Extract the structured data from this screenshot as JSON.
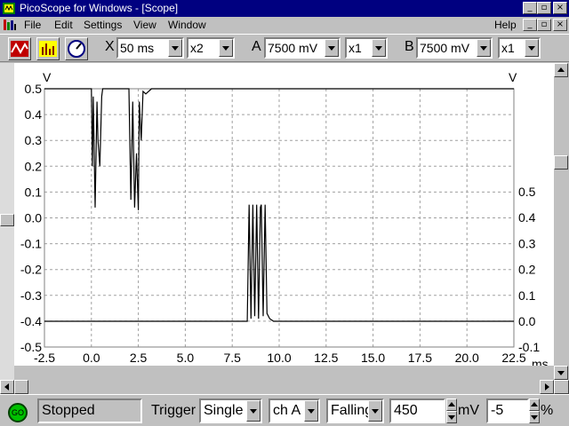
{
  "window": {
    "title": "PicoScope for Windows - [Scope]"
  },
  "menu": {
    "file": "File",
    "edit": "Edit",
    "settings": "Settings",
    "view": "View",
    "window": "Window",
    "help": "Help"
  },
  "toolbar": {
    "x_label": "X",
    "timebase": "50 ms",
    "x_mult": "x2",
    "a_label": "A",
    "a_range": "7500 mV",
    "a_mult": "x1",
    "b_label": "B",
    "b_range": "7500 mV",
    "b_mult": "x1"
  },
  "status": {
    "go": "GO",
    "state": "Stopped",
    "trigger_label": "Trigger",
    "mode": "Single",
    "channel": "ch A",
    "edge": "Falling",
    "level": "450",
    "level_unit": "mV",
    "delay": "-5",
    "delay_unit": "%"
  },
  "chart_data": {
    "type": "line",
    "xlabel": "ms",
    "left_ylabel": "V",
    "right_ylabel": "V",
    "x_ticks": [
      "-2.5",
      "0.0",
      "2.5",
      "5.0",
      "7.5",
      "10.0",
      "12.5",
      "15.0",
      "17.5",
      "20.0",
      "22.5"
    ],
    "left_ticks": [
      "0.5",
      "0.4",
      "0.3",
      "0.2",
      "0.1",
      "0.0",
      "-0.1",
      "-0.2",
      "-0.3",
      "-0.4",
      "-0.5"
    ],
    "right_ticks": [
      "0.5",
      "0.4",
      "0.3",
      "0.2",
      "0.1",
      "0.0",
      "-0.1"
    ],
    "xlim": [
      -2.5,
      22.5
    ],
    "left_ylim": [
      -0.5,
      0.5
    ],
    "right_ylim": [
      -0.1,
      0.5
    ],
    "grid": true,
    "series": [
      {
        "axis": "left",
        "color": "#000000",
        "x": [
          -2.5,
          0.0,
          0.05,
          0.1,
          0.2,
          0.3,
          0.35,
          0.45,
          0.55,
          0.6,
          0.7,
          2.0,
          2.1,
          2.2,
          2.3,
          2.4,
          2.5,
          2.55,
          2.65,
          2.75,
          2.9,
          3.2,
          22.5
        ],
        "y": [
          0.5,
          0.5,
          0.2,
          0.47,
          0.04,
          0.45,
          0.3,
          0.2,
          0.47,
          0.5,
          0.5,
          0.5,
          0.07,
          0.45,
          0.04,
          0.25,
          0.03,
          0.45,
          0.3,
          0.49,
          0.48,
          0.5,
          0.5
        ]
      },
      {
        "axis": "right",
        "color": "#000000",
        "x": [
          -2.5,
          8.3,
          8.4,
          8.5,
          8.6,
          8.7,
          8.8,
          8.9,
          9.0,
          9.05,
          9.15,
          9.25,
          9.35,
          9.5,
          9.7,
          22.5
        ],
        "y": [
          0.0,
          0.0,
          0.45,
          0.01,
          0.45,
          0.02,
          0.45,
          0.01,
          0.44,
          0.45,
          0.02,
          0.45,
          0.03,
          0.01,
          0.0,
          0.0
        ]
      }
    ]
  }
}
